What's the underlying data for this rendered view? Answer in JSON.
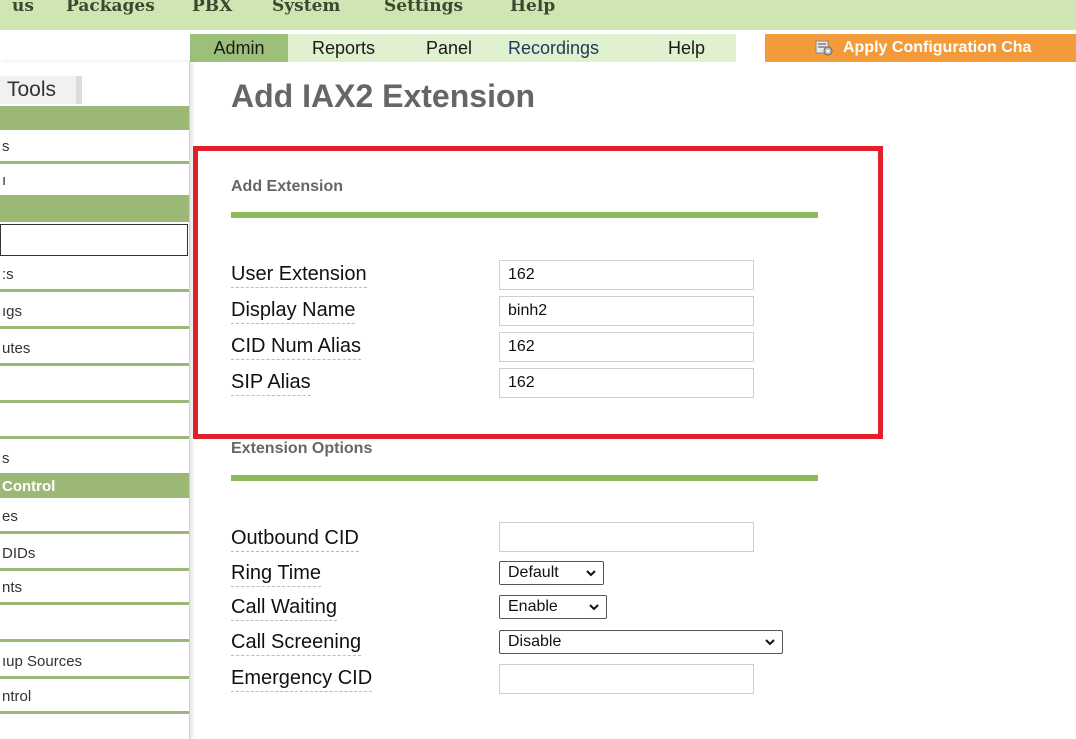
{
  "top_menu": [
    "us",
    "Packages",
    "PBX",
    "System",
    "Settings",
    "Help"
  ],
  "sub_nav": {
    "tabs": [
      {
        "label": "Admin",
        "active": true
      },
      {
        "label": "Reports",
        "active": false
      },
      {
        "label": "Panel",
        "active": false
      },
      {
        "label": "Recordings",
        "active": false
      },
      {
        "label": "Help",
        "active": false
      }
    ],
    "apply_label": "Apply Configuration Cha"
  },
  "sidebar": {
    "tools_label": "Tools",
    "items": [
      "s",
      "ı",
      "",
      ":s",
      "ıgs",
      "utes",
      "",
      "",
      "s",
      "es",
      "DIDs",
      "nts",
      "",
      "ıup Sources",
      "ntrol"
    ],
    "section_header": "Control"
  },
  "page": {
    "title": "Add IAX2 Extension",
    "add_extension": {
      "title": "Add Extension",
      "fields": [
        {
          "label": "User Extension",
          "value": "162"
        },
        {
          "label": "Display Name",
          "value": "binh2"
        },
        {
          "label": "CID Num Alias",
          "value": "162"
        },
        {
          "label": "SIP Alias",
          "value": "162"
        }
      ]
    },
    "extension_options": {
      "title": "Extension Options",
      "outbound_cid_label": "Outbound CID",
      "outbound_cid_value": "",
      "ring_time_label": "Ring Time",
      "ring_time_value": "Default",
      "call_waiting_label": "Call Waiting",
      "call_waiting_value": "Enable",
      "call_screening_label": "Call Screening",
      "call_screening_value": "Disable",
      "emergency_cid_label": "Emergency CID",
      "emergency_cid_value": ""
    }
  },
  "colors": {
    "accent_green": "#8dbb5c",
    "apply_orange": "#f39a3a",
    "highlight_red": "#e2202b"
  }
}
